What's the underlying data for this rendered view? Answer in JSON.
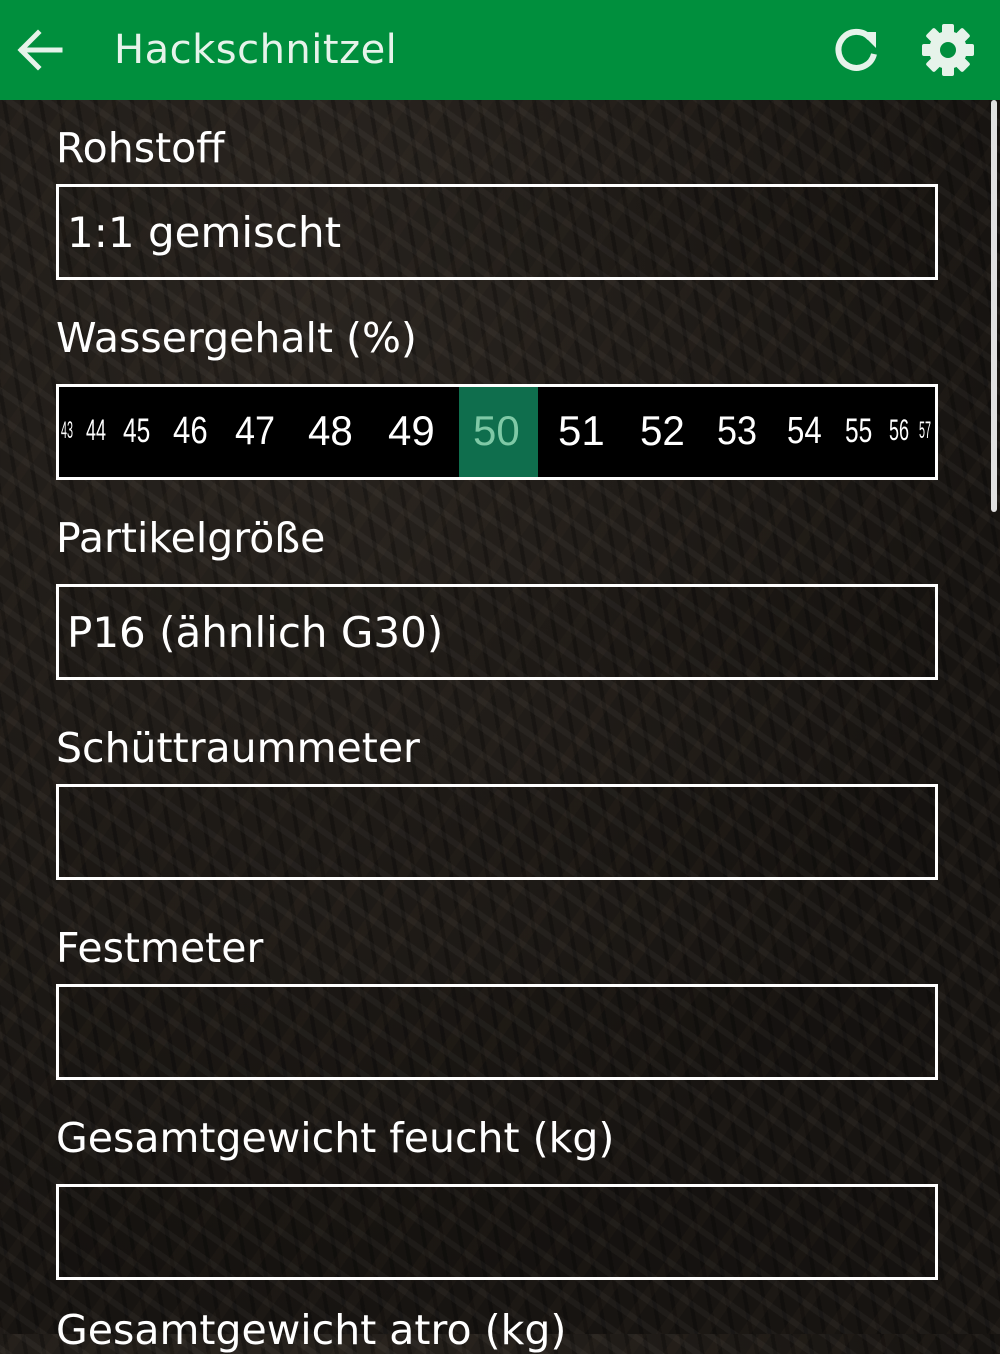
{
  "app_bar": {
    "title": "Hackschnitzel",
    "color": "#008f3d",
    "icons": [
      "arrow-left-icon",
      "refresh-icon",
      "gear-icon"
    ]
  },
  "form": {
    "rohstoff": {
      "label": "Rohstoff",
      "value": "1:1 gemischt"
    },
    "wassergehalt": {
      "label": "Wassergehalt (%)",
      "values": [
        "43",
        "44",
        "45",
        "46",
        "47",
        "48",
        "49",
        "50",
        "51",
        "52",
        "53",
        "54",
        "55",
        "56",
        "57"
      ],
      "selected": "50",
      "selected_color": "#0f6e4d"
    },
    "partikelgroesse": {
      "label": "Partikelgröße",
      "value": "P16 (ähnlich G30)"
    },
    "schuettraummeter": {
      "label": "Schüttraummeter",
      "value": ""
    },
    "festmeter": {
      "label": "Festmeter",
      "value": ""
    },
    "gesamtgewicht_feucht": {
      "label": "Gesamtgewicht feucht (kg)",
      "value": ""
    },
    "gesamtgewicht_atro": {
      "label": "Gesamtgewicht atro (kg)"
    }
  }
}
